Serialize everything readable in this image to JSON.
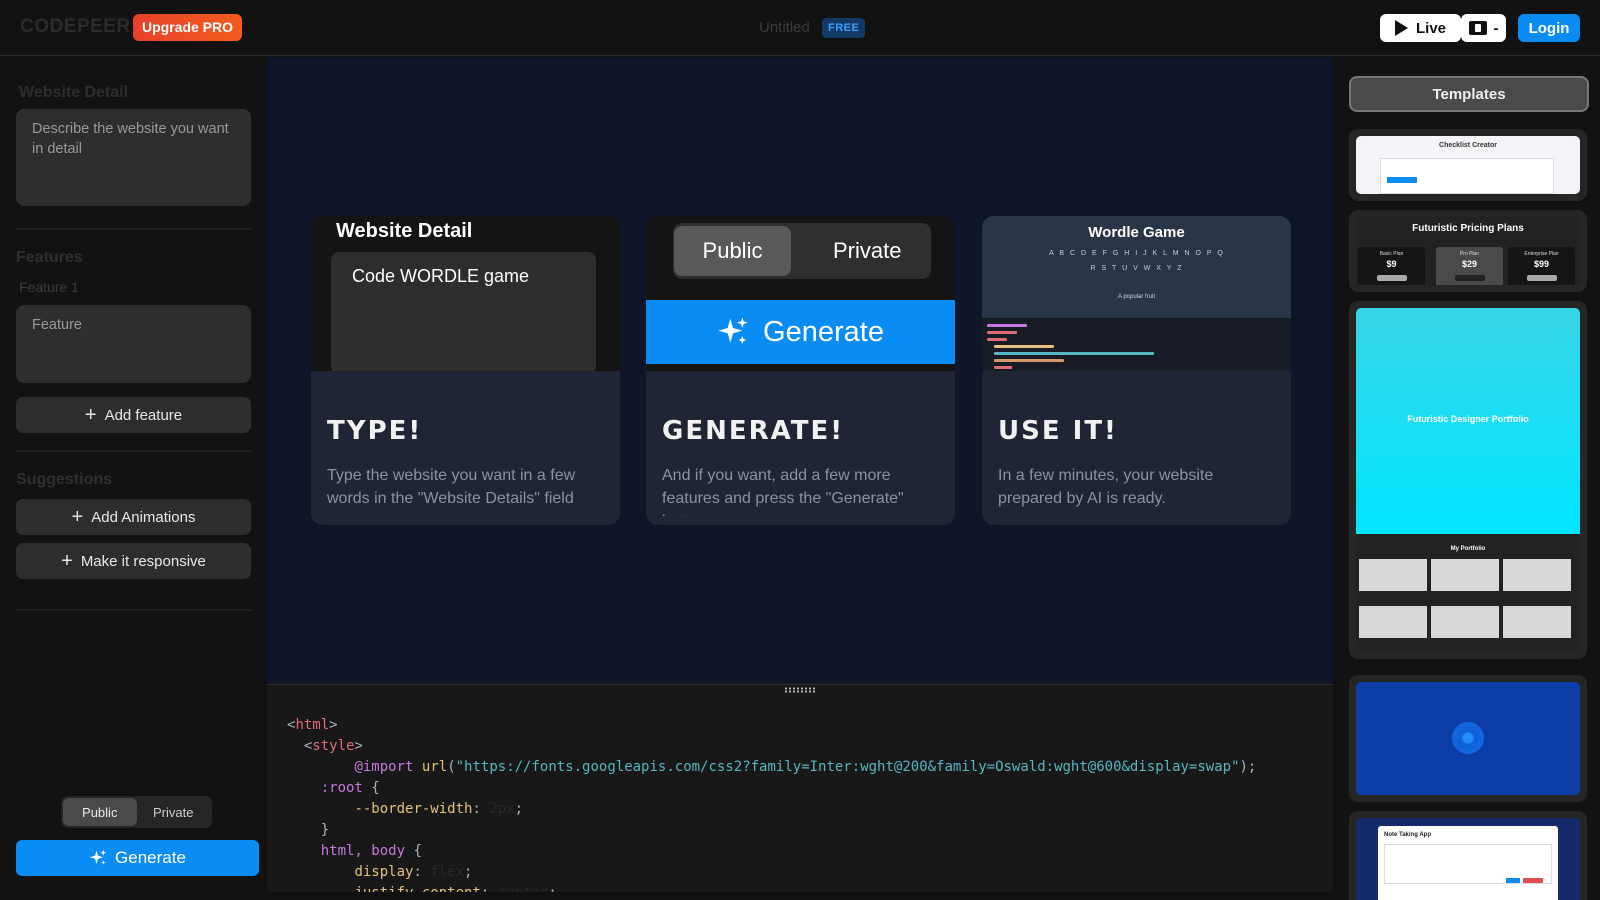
{
  "header": {
    "logo": "CODEPEER",
    "upgrade_label": "Upgrade PRO",
    "doc_title": "Untitled",
    "plan_badge": "FREE",
    "live_label": "Live",
    "tokens_label": "-",
    "login_label": "Login"
  },
  "sidebar": {
    "website_detail_title": "Website Detail",
    "website_detail_placeholder": "Describe the website you want in detail",
    "features_title": "Features",
    "feature_1_label": "Feature 1",
    "feature_placeholder": "Feature",
    "add_feature_label": "Add feature",
    "suggestions_title": "Suggestions",
    "suggestions": [
      "Add Animations",
      "Make it responsive"
    ],
    "visibility_options": [
      "Public",
      "Private"
    ],
    "visibility_selected": "Public",
    "generate_label": "Generate"
  },
  "steps": [
    {
      "heading": "TYPE!",
      "text": "Type the website you want in a few words in the \"Website Details\" field",
      "image": {
        "title": "Website Detail",
        "input_text": "Code WORDLE game"
      }
    },
    {
      "heading": "GENERATE!",
      "text": "And if you want, add a few more features and press the \"Generate\" button",
      "image": {
        "public_label": "Public",
        "private_label": "Private",
        "generate_label": "Generate"
      }
    },
    {
      "heading": "USE IT!",
      "text": "In a few minutes, your website prepared by AI is ready.",
      "image": {
        "title": "Wordle Game",
        "keys_row_1": "A B C D E F G H I J K L M N O P Q",
        "keys_row_2": "R S T U V W X Y Z",
        "hint": "A popular fruit"
      }
    }
  ],
  "editor": {
    "lines": [
      [
        {
          "t": "<",
          "c": "punc"
        },
        {
          "t": "html",
          "c": "tag"
        },
        {
          "t": ">",
          "c": "punc"
        }
      ],
      [
        {
          "t": "  <",
          "c": "punc"
        },
        {
          "t": "style",
          "c": "tag"
        },
        {
          "t": ">",
          "c": "punc"
        }
      ],
      [
        {
          "t": "        ",
          "c": "punc"
        },
        {
          "t": "@import",
          "c": "at"
        },
        {
          "t": " ",
          "c": "punc"
        },
        {
          "t": "url",
          "c": "fn"
        },
        {
          "t": "(",
          "c": "punc"
        },
        {
          "t": "\"https://fonts.googleapis.com/css2?family=Inter:wght@200&family=Oswald:wght@600&display=swap\"",
          "c": "str"
        },
        {
          "t": ");",
          "c": "punc"
        }
      ],
      [
        {
          "t": "    ",
          "c": "punc"
        },
        {
          "t": ":root",
          "c": "sel"
        },
        {
          "t": " {",
          "c": "punc"
        }
      ],
      [
        {
          "t": "        ",
          "c": "punc"
        },
        {
          "t": "--border-width",
          "c": "prop"
        },
        {
          "t": ": ",
          "c": "punc"
        },
        {
          "t": "2px",
          "c": "val"
        },
        {
          "t": ";",
          "c": "punc"
        }
      ],
      [
        {
          "t": "    }",
          "c": "punc"
        }
      ],
      [
        {
          "t": "    ",
          "c": "punc"
        },
        {
          "t": "html, body",
          "c": "sel"
        },
        {
          "t": " {",
          "c": "punc"
        }
      ],
      [
        {
          "t": "        ",
          "c": "punc"
        },
        {
          "t": "display",
          "c": "prop"
        },
        {
          "t": ": ",
          "c": "punc"
        },
        {
          "t": "flex",
          "c": "val"
        },
        {
          "t": ";",
          "c": "punc"
        }
      ],
      [
        {
          "t": "        ",
          "c": "punc"
        },
        {
          "t": "justify-content",
          "c": "prop"
        },
        {
          "t": ": ",
          "c": "punc"
        },
        {
          "t": "center",
          "c": "val"
        },
        {
          "t": ";",
          "c": "punc"
        }
      ]
    ]
  },
  "templates": {
    "title": "Templates",
    "items": [
      {
        "name": "Checklist Creator"
      },
      {
        "name": "Futuristic Pricing Plans",
        "plans": [
          {
            "title": "Basic Plan",
            "price": "$9"
          },
          {
            "title": "Pro Plan",
            "price": "$29"
          },
          {
            "title": "Enterprise Plan",
            "price": "$99"
          }
        ]
      },
      {
        "name": "Futuristic Designer Portfolio",
        "section": "My Portfolio"
      },
      {
        "name": ""
      },
      {
        "name": "Note Taking App"
      }
    ]
  },
  "colors": {
    "accent": "#0a8cf5",
    "upgrade": "#ee4d23",
    "center_bg": "#0f1629",
    "card_bg": "#1f2535"
  }
}
